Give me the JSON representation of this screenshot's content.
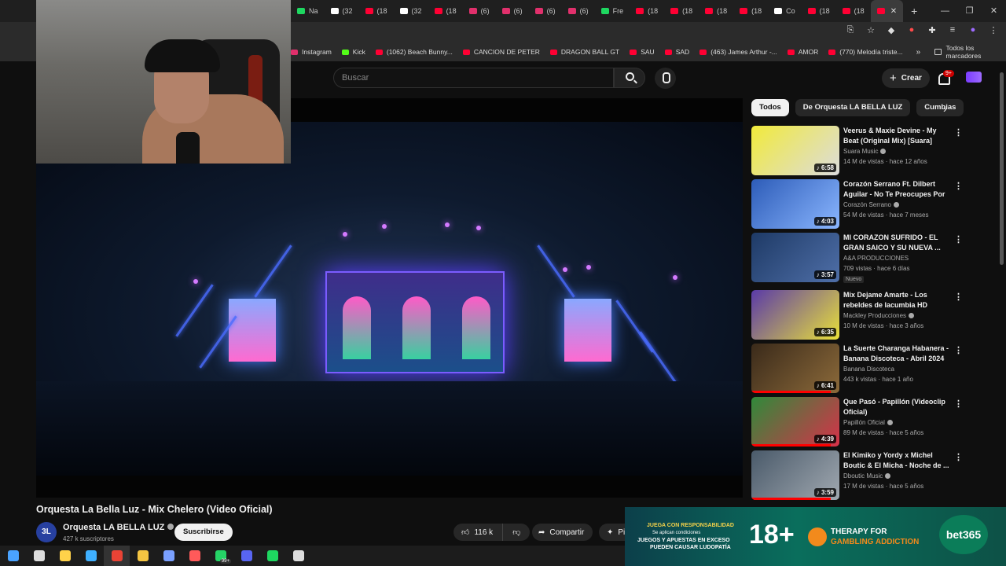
{
  "browser": {
    "tabs": [
      {
        "label": "Na",
        "color": "#1ed760"
      },
      {
        "label": "(32",
        "color": "#ffffff"
      },
      {
        "label": "(18",
        "color": "#ff0033"
      },
      {
        "label": "(32",
        "color": "#ffffff"
      },
      {
        "label": "(18",
        "color": "#ff0033"
      },
      {
        "label": "(6)",
        "color": "#e1306c"
      },
      {
        "label": "(6)",
        "color": "#e1306c"
      },
      {
        "label": "(6)",
        "color": "#e1306c"
      },
      {
        "label": "(6)",
        "color": "#e1306c"
      },
      {
        "label": "Fre",
        "color": "#1ed760"
      },
      {
        "label": "(18",
        "color": "#ff0033"
      },
      {
        "label": "(18",
        "color": "#ff0033"
      },
      {
        "label": "(18",
        "color": "#ff0033"
      },
      {
        "label": "(18",
        "color": "#ff0033"
      },
      {
        "label": "Co",
        "color": "#ffffff"
      },
      {
        "label": "(18",
        "color": "#ff0033"
      },
      {
        "label": "(18",
        "color": "#ff0033"
      }
    ],
    "bookmarks": [
      {
        "label": "Instagram",
        "color": "#e1306c"
      },
      {
        "label": "Kick",
        "color": "#53fc18"
      },
      {
        "label": "(1062) Beach Bunny...",
        "color": "#ff0033"
      },
      {
        "label": "CANCION DE PETER",
        "color": "#ff0033"
      },
      {
        "label": "DRAGON BALL GT",
        "color": "#ff0033"
      },
      {
        "label": "SAU",
        "color": "#ff0033"
      },
      {
        "label": "SAD",
        "color": "#ff0033"
      },
      {
        "label": "(463) James Arthur -...",
        "color": "#ff0033"
      },
      {
        "label": "AMOR",
        "color": "#ff0033"
      },
      {
        "label": "(770) Melodía triste...",
        "color": "#ff0033"
      }
    ],
    "all_bookmarks": "Todos los marcadores"
  },
  "header": {
    "search_placeholder": "Buscar",
    "create_label": "Crear",
    "notifications_badge": "9+"
  },
  "video": {
    "title": "Orquesta La Bella Luz - Mix Chelero (Video Oficial)",
    "channel_name": "Orquesta LA BELLA LUZ",
    "channel_avatar_text": "3L",
    "subscribers": "427 k suscriptores",
    "subscribe_label": "Suscribirse",
    "likes": "116 k",
    "share_label": "Compartir",
    "more_label": "Pi"
  },
  "chips": [
    "Todos",
    "De Orquesta LA BELLA LUZ",
    "Cumbias"
  ],
  "recommendations": [
    {
      "title": "Veerus & Maxie Devine - My Beat (Original Mix) [Suara]",
      "channel": "Suara Music",
      "verified": true,
      "meta": "14 M de vistas · hace 12 años",
      "duration": "6:58",
      "badge": "",
      "thumb": [
        "#f1ea3a",
        "#dcdcdc"
      ],
      "watched": 0
    },
    {
      "title": "Corazón Serrano Ft. Dilbert Aguilar - No Te Preocupes Por ...",
      "channel": "Corazón Serrano",
      "verified": true,
      "meta": "54 M de vistas · hace 7 meses",
      "duration": "4:03",
      "badge": "",
      "thumb": [
        "#2d5cb8",
        "#8ab6ff"
      ],
      "watched": 0
    },
    {
      "title": "MI CORAZON SUFRIDO - EL GRAN SAICO Y SU NUEVA ...",
      "channel": "A&A PRODUCCIONES",
      "verified": false,
      "meta": "709 vistas · hace 6 días",
      "duration": "3:57",
      "badge": "Nuevo",
      "thumb": [
        "#1e3a66",
        "#4f6fa8"
      ],
      "watched": 0
    },
    {
      "title": "Mix Dejame Amarte - Los rebeldes de lacumbia HD",
      "channel": "Mackley Producciones",
      "verified": true,
      "meta": "10 M de vistas · hace 3 años",
      "duration": "6:35",
      "badge": "",
      "thumb": [
        "#5a3aa8",
        "#e9e03a"
      ],
      "watched": 0
    },
    {
      "title": "La Suerte Charanga Habanera - Banana Discoteca - Abril 2024",
      "channel": "Banana Discoteca",
      "verified": false,
      "meta": "443 k vistas · hace 1 año",
      "duration": "6:41",
      "badge": "",
      "thumb": [
        "#3a2a1a",
        "#8c6a3a"
      ],
      "watched": 0.9
    },
    {
      "title": "Que Pasó - Papillón (Videoclip Oficial)",
      "channel": "Papillón Oficial",
      "verified": true,
      "meta": "89 M de vistas · hace 5 años",
      "duration": "4:39",
      "badge": "",
      "thumb": [
        "#2f8a3a",
        "#d8314a"
      ],
      "watched": 0.9
    },
    {
      "title": "El Kimiko y Yordy x Michel Boutic & El Micha - Noche de ...",
      "channel": "Dboutic Music",
      "verified": true,
      "meta": "17 M de vistas · hace 5 años",
      "duration": "3:59",
      "badge": "",
      "thumb": [
        "#4a5a6a",
        "#a0a8b0"
      ],
      "watched": 0.9
    }
  ],
  "ad": {
    "line1": "JUEGA CON RESPONSABILIDAD",
    "line2": "Se aplican condiciones",
    "line3": "JUEGOS Y APUESTAS EN EXCESO",
    "line4": "PUEDEN CAUSAR LUDOPATÍA",
    "age": "18+",
    "therapy1": "THERAPY FOR",
    "therapy2": "GAMBLING ADDICTION",
    "brand": "bet365"
  },
  "taskbar": {
    "apps": [
      {
        "name": "start",
        "color": "#4aa3ff"
      },
      {
        "name": "search",
        "color": "#dddddd"
      },
      {
        "name": "store",
        "color": "#ffd24a"
      },
      {
        "name": "edge",
        "color": "#3fb0ff"
      },
      {
        "name": "chrome",
        "color": "#ea4335"
      },
      {
        "name": "explorer",
        "color": "#f5c542"
      },
      {
        "name": "app",
        "color": "#7aa0ff"
      },
      {
        "name": "app2",
        "color": "#ff5a5a"
      },
      {
        "name": "whatsapp",
        "color": "#25d366"
      },
      {
        "name": "discord",
        "color": "#5865f2"
      },
      {
        "name": "spotify",
        "color": "#1ed760"
      },
      {
        "name": "app3",
        "color": "#dddddd"
      }
    ],
    "whatsapp_badge": "99+"
  }
}
